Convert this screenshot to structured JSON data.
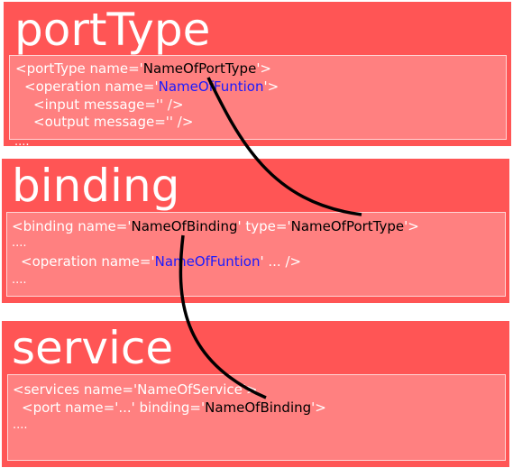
{
  "sections": {
    "porttype": {
      "title": "portType",
      "lines": {
        "l1": {
          "a": "<portType name='",
          "b": "NameOfPortType",
          "c": "'>"
        },
        "l2": {
          "a": "<operation name='",
          "b": "NameOfFuntion",
          "c": "'>"
        },
        "l3": "<input message='' />",
        "l4": "<output message='' />",
        "l5": "...."
      }
    },
    "binding": {
      "title": "binding",
      "lines": {
        "l1": {
          "a": "<binding name='",
          "b": "NameOfBinding",
          "c": "' type='",
          "d": "NameOfPortType",
          "e": "'>"
        },
        "l2": "....",
        "l3": {
          "a": "<operation name='",
          "b": "NameOfFuntion",
          "c": "' ... />"
        },
        "l4": "...."
      }
    },
    "service": {
      "title": "service",
      "lines": {
        "l1": "<services name='NameOfService'>",
        "l2": {
          "a": "<port name='...' binding='",
          "b": "NameOfBinding",
          "c": "'>"
        },
        "l3": "...."
      }
    }
  },
  "colors": {
    "section_bg": "#ff5555",
    "code_bg": "#ff8080",
    "highlight_text": "#000000",
    "function_text": "#1a1aff",
    "connector": "#000000"
  }
}
